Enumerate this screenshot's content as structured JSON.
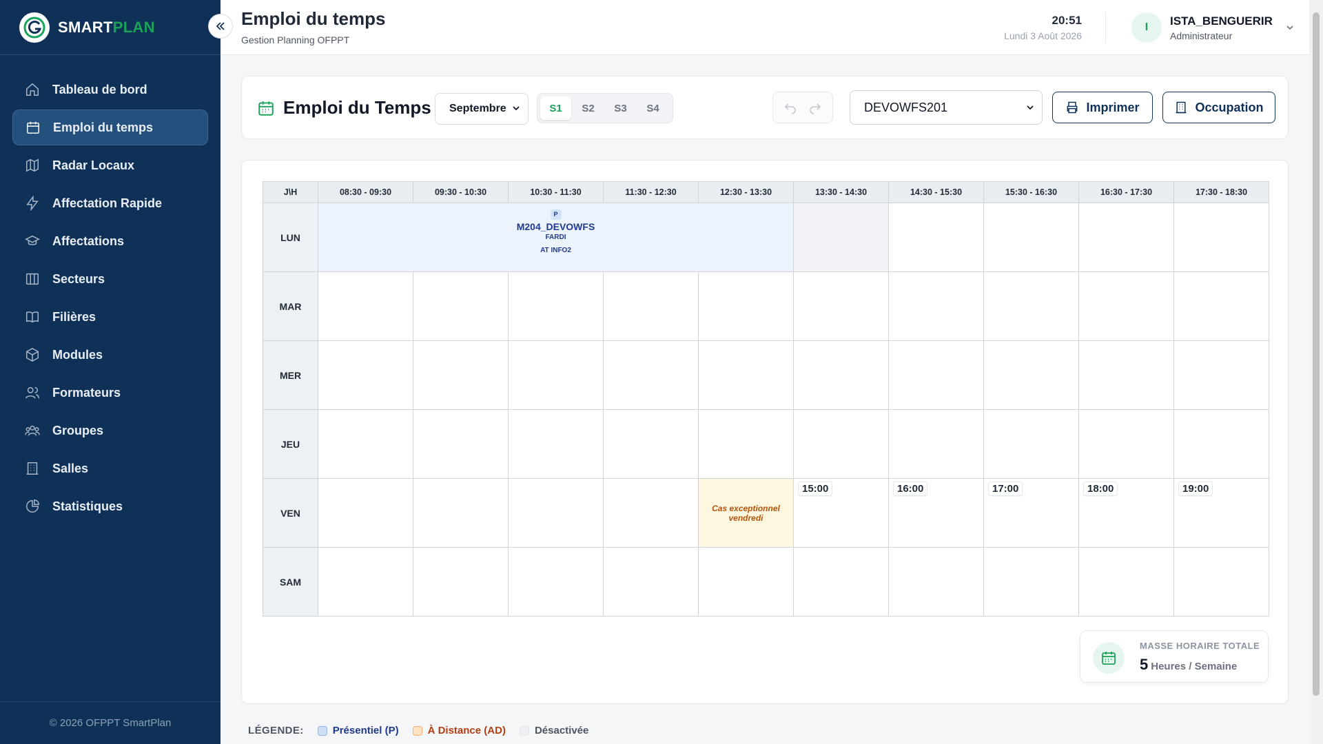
{
  "brand": {
    "part1": "SMART",
    "part2": "PLAN"
  },
  "sidebar": {
    "items": [
      {
        "label": "Tableau de bord",
        "icon": "home-icon"
      },
      {
        "label": "Emploi du temps",
        "icon": "calendar-icon",
        "active": true
      },
      {
        "label": "Radar Locaux",
        "icon": "map-icon"
      },
      {
        "label": "Affectation Rapide",
        "icon": "lightning-icon"
      },
      {
        "label": "Affectations",
        "icon": "graduation-cap-icon"
      },
      {
        "label": "Secteurs",
        "icon": "columns-icon"
      },
      {
        "label": "Filières",
        "icon": "book-icon"
      },
      {
        "label": "Modules",
        "icon": "cube-icon"
      },
      {
        "label": "Formateurs",
        "icon": "users-icon"
      },
      {
        "label": "Groupes",
        "icon": "group-icon"
      },
      {
        "label": "Salles",
        "icon": "building-icon"
      },
      {
        "label": "Statistiques",
        "icon": "pie-chart-icon"
      }
    ],
    "footer": "© 2026 OFPPT SmartPlan"
  },
  "header": {
    "title": "Emploi du temps",
    "subtitle": "Gestion Planning OFPPT",
    "time": "20:51",
    "date": "Lundi 3 Août 2026",
    "user_initial": "I",
    "user_name": "ISTA_BENGUERIR",
    "user_role": "Administrateur"
  },
  "toolbar": {
    "title": "Emploi du Temps",
    "month": "Septembre",
    "weeks": [
      "S1",
      "S2",
      "S3",
      "S4"
    ],
    "active_week": "S1",
    "group": "DEVOWFS201",
    "print_label": "Imprimer",
    "occupation_label": "Occupation"
  },
  "schedule": {
    "corner": "J\\H",
    "slots": [
      "08:30 - 09:30",
      "09:30 - 10:30",
      "10:30 - 11:30",
      "11:30 - 12:30",
      "12:30 - 13:30",
      "13:30 - 14:30",
      "14:30 - 15:30",
      "15:30 - 16:30",
      "16:30 - 17:30",
      "17:30 - 18:30"
    ],
    "days": [
      "LUN",
      "MAR",
      "MER",
      "JEU",
      "VEN",
      "SAM"
    ],
    "session": {
      "badge": "P",
      "module": "M204_DEVOWFS",
      "trainer": "FARDI",
      "room": "AT INFO2"
    },
    "exception": "Cas exceptionnel vendredi",
    "friday_hours": [
      "15:00",
      "16:00",
      "17:00",
      "18:00",
      "19:00"
    ]
  },
  "masse": {
    "label": "MASSE HORAIRE TOTALE",
    "value": "5",
    "unit": "Heures / Semaine"
  },
  "legend": {
    "title": "LÉGENDE:",
    "presentiel": "Présentiel (P)",
    "distance": "À Distance (AD)",
    "off": "Désactivée"
  },
  "colors": {
    "sidebar_bg": "#0f3157",
    "accent_green": "#19a35a",
    "session_bg": "#ecf3fd",
    "exception_bg": "#fdf7e0"
  }
}
